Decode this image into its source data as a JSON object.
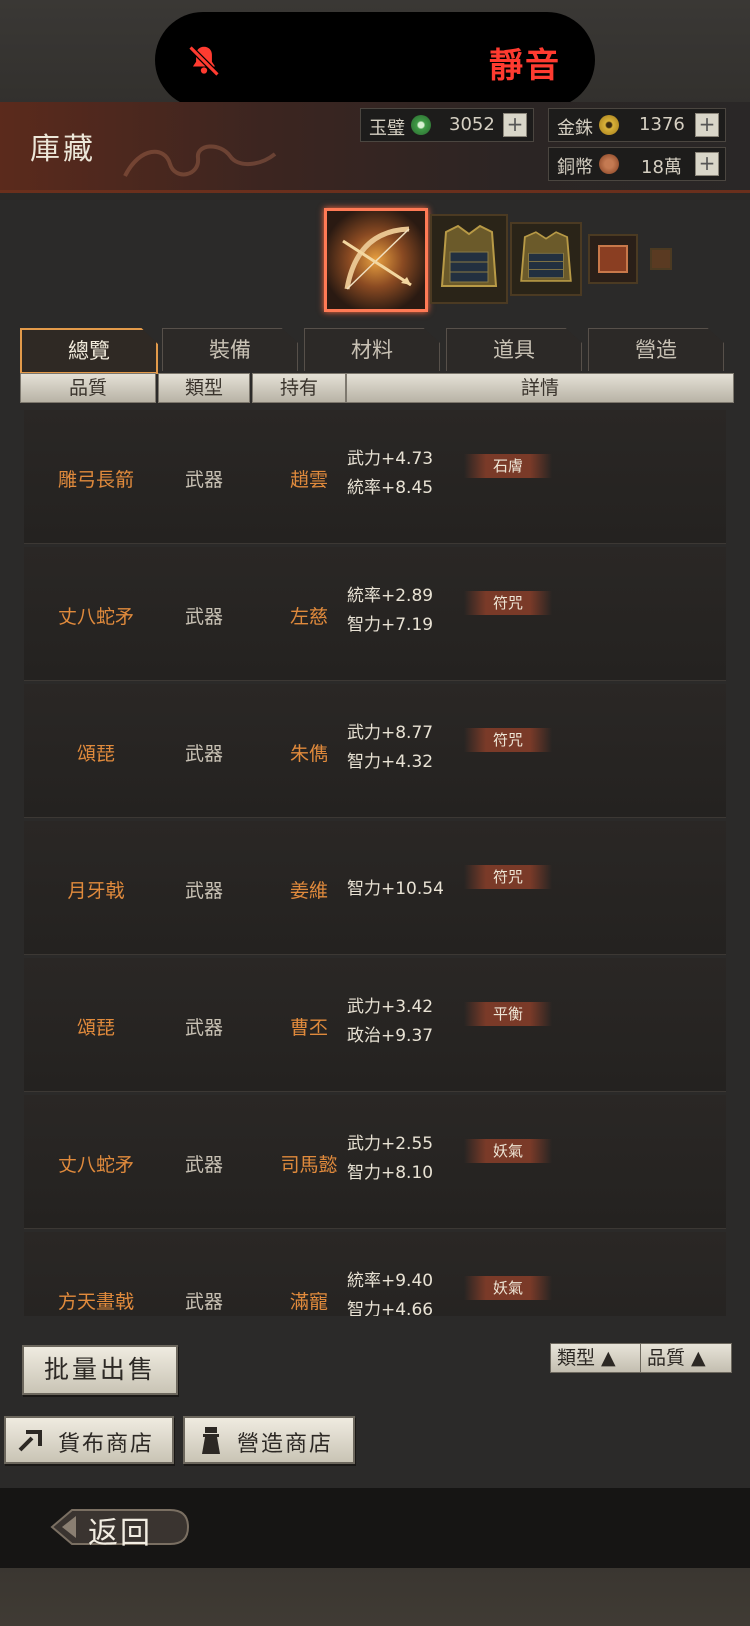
{
  "notification": {
    "label": "靜音",
    "icon": "bell-slash-icon",
    "color": "#ff3b30"
  },
  "header": {
    "title": "庫藏"
  },
  "currencies": [
    {
      "name": "玉璧",
      "value": "3052",
      "coin_color": "#3f9a45",
      "icon": "jade-coin-icon"
    },
    {
      "name": "金銖",
      "value": "1376",
      "coin_color": "#c9a227",
      "icon": "gold-coin-icon"
    },
    {
      "name": "銅幣",
      "value": "18萬",
      "coin_color": "#b0623a",
      "icon": "copper-coin-icon"
    }
  ],
  "plus_label": "+",
  "carousel": [
    "bow-arrow-item",
    "armor-item",
    "armor-item",
    "book-item",
    "small-item"
  ],
  "tabs": [
    "總覽",
    "裝備",
    "材料",
    "道具",
    "營造"
  ],
  "active_tab": "總覽",
  "columns": [
    "品質",
    "類型",
    "持有",
    "詳情"
  ],
  "rows": [
    {
      "name": "雕弓長箭",
      "type": "武器",
      "holder": "趙雲",
      "stat1": "武力+4.73",
      "stat2": "統率+8.45",
      "tag": "石膚"
    },
    {
      "name": "丈八蛇矛",
      "type": "武器",
      "holder": "左慈",
      "stat1": "統率+2.89",
      "stat2": "智力+7.19",
      "tag": "符咒"
    },
    {
      "name": "頌琵",
      "type": "武器",
      "holder": "朱儁",
      "stat1": "武力+8.77",
      "stat2": "智力+4.32",
      "tag": "符咒"
    },
    {
      "name": "月牙戟",
      "type": "武器",
      "holder": "姜維",
      "stat1": "智力+10.54",
      "stat2": "",
      "tag": "符咒"
    },
    {
      "name": "頌琵",
      "type": "武器",
      "holder": "曹丕",
      "stat1": "武力+3.42",
      "stat2": "政治+9.37",
      "tag": "平衡"
    },
    {
      "name": "丈八蛇矛",
      "type": "武器",
      "holder": "司馬懿",
      "stat1": "武力+2.55",
      "stat2": "智力+8.10",
      "tag": "妖氣"
    },
    {
      "name": "方天畫戟",
      "type": "武器",
      "holder": "滿寵",
      "stat1": "統率+9.40",
      "stat2": "智力+4.66",
      "tag": "妖氣"
    }
  ],
  "sort": {
    "type_label": "類型 ▲",
    "quality_label": "品質 ▲"
  },
  "buttons": {
    "batch_sell": "批量出售",
    "currency_shop": "貨布商店",
    "build_shop": "營造商店",
    "back": "返回"
  }
}
